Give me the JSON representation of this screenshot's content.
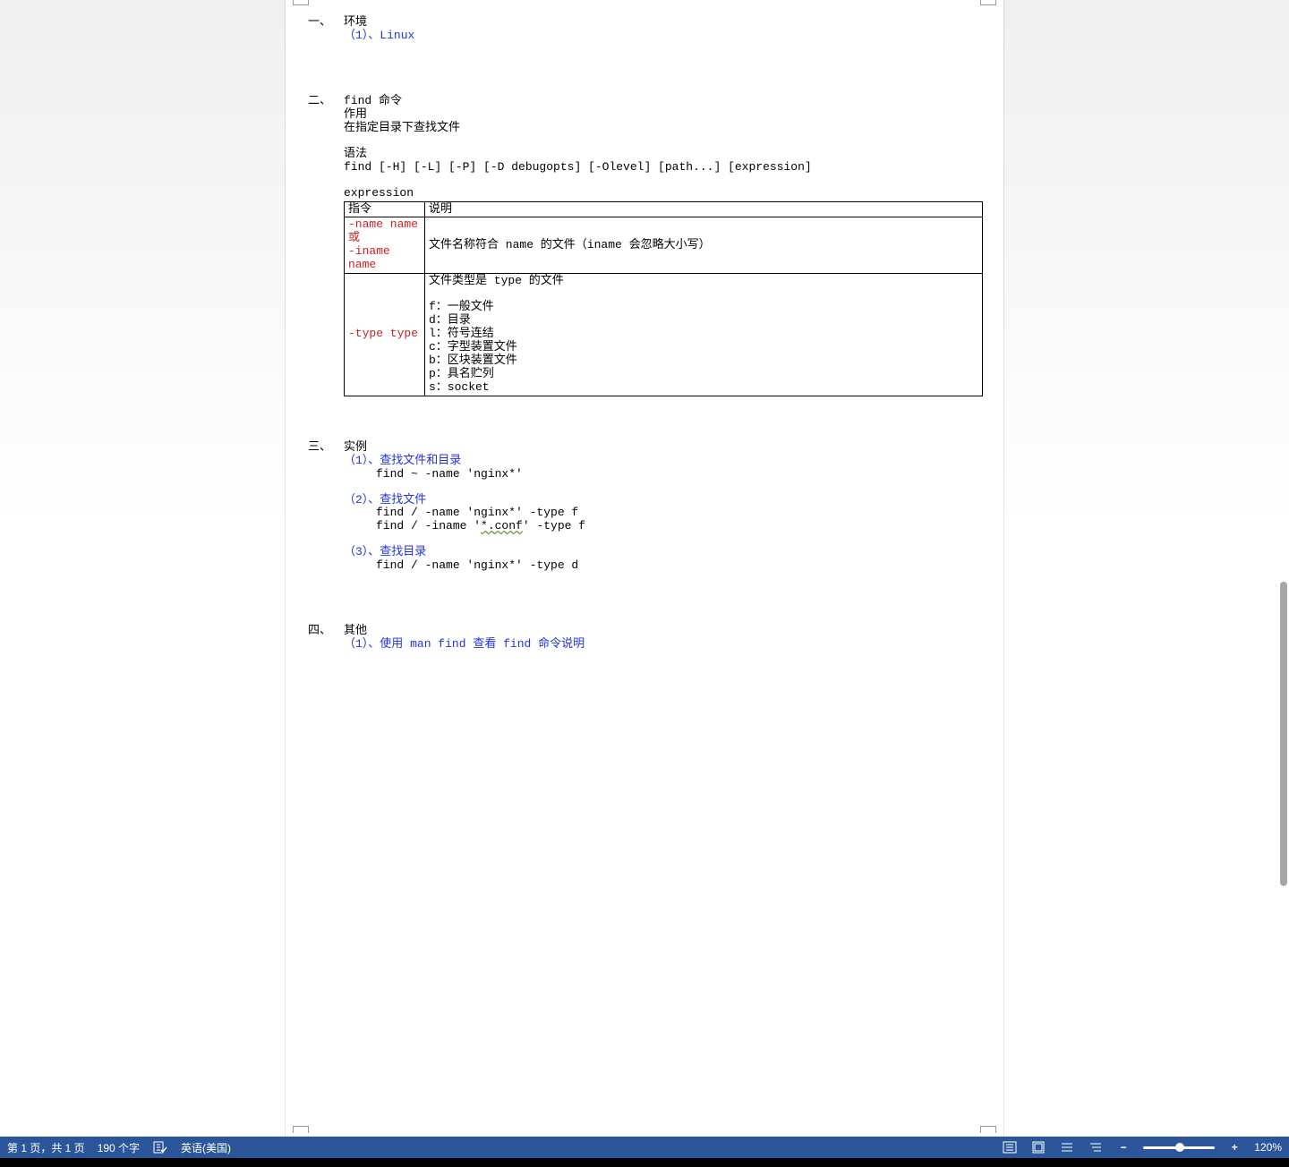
{
  "sections": {
    "s1": {
      "num": "一、",
      "title": "环境",
      "sub1": "（1）、Linux"
    },
    "s2": {
      "num": "二、",
      "title": "find 命令",
      "line1": "作用",
      "line2": "在指定目录下查找文件",
      "line3": "语法",
      "line4": "find [-H] [-L] [-P] [-D debugopts] [-Olevel] [path...] [expression]",
      "tableTitle": "expression",
      "th1": "指令",
      "th2": "说明",
      "r1c1a": "-name name",
      "r1c1b": "或",
      "r1c1c": "-iname name",
      "r1c2": "文件名称符合 name 的文件（iname 会忽略大小写）",
      "r2c1": "-type type",
      "r2c2a": "文件类型是 type 的文件",
      "r2c2_f": "f：一般文件",
      "r2c2_d": "d：目录",
      "r2c2_l": "l：符号连结",
      "r2c2_c": "c：字型装置文件",
      "r2c2_b": "b：区块装置文件",
      "r2c2_p": "p：具名贮列",
      "r2c2_s": "s：socket"
    },
    "s3": {
      "num": "三、",
      "title": "实例",
      "g1_title": "（1）、查找文件和目录",
      "g1_l1": "find ~ -name 'nginx*'",
      "g2_title": "（2）、查找文件",
      "g2_l1": "find / -name 'nginx*' -type f",
      "g2_l2a": "find / -iname '",
      "g2_l2_spell": "*.conf",
      "g2_l2b": "' -type f",
      "g3_title": "（3）、查找目录",
      "g3_l1": "find / -name 'nginx*' -type d"
    },
    "s4": {
      "num": "四、",
      "title": "其他",
      "sub1": "（1）、使用 man find 查看 find 命令说明"
    }
  },
  "status": {
    "page": "第 1 页，共 1 页",
    "words": "190 个字",
    "lang": "英语(美国)",
    "zoom": "120%"
  }
}
